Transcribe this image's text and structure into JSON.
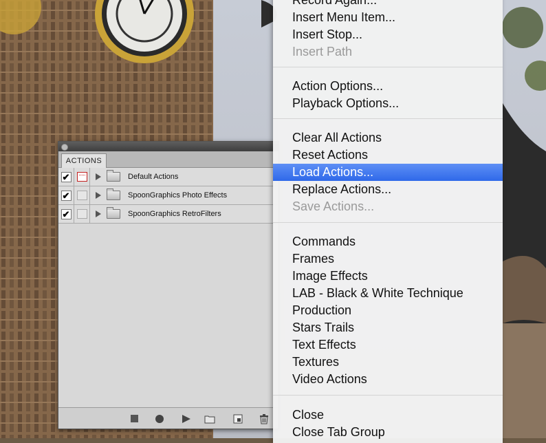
{
  "actions_panel": {
    "tab_label": "ACTIONS",
    "sets": [
      {
        "label": "Default Actions",
        "checked": true,
        "dialog_toggle": "red"
      },
      {
        "label": "SpoonGraphics Photo Effects",
        "checked": true,
        "dialog_toggle": "empty"
      },
      {
        "label": "SpoonGraphics RetroFilters",
        "checked": true,
        "dialog_toggle": "empty"
      }
    ],
    "check_glyph": "✔",
    "footer_icons": [
      "stop-icon",
      "record-icon",
      "play-icon",
      "new-set-folder-icon",
      "new-action-icon",
      "trash-icon"
    ]
  },
  "menu": {
    "items": [
      {
        "label": "Record Again...",
        "state": "normal"
      },
      {
        "label": "Insert Menu Item...",
        "state": "normal"
      },
      {
        "label": "Insert Stop...",
        "state": "normal"
      },
      {
        "label": "Insert Path",
        "state": "disabled"
      },
      {
        "label": "Action Options...",
        "state": "normal"
      },
      {
        "label": "Playback Options...",
        "state": "normal"
      },
      {
        "label": "Clear All Actions",
        "state": "normal"
      },
      {
        "label": "Reset Actions",
        "state": "normal"
      },
      {
        "label": "Load Actions...",
        "state": "highlight"
      },
      {
        "label": "Replace Actions...",
        "state": "normal"
      },
      {
        "label": "Save Actions...",
        "state": "disabled"
      },
      {
        "label": "Commands",
        "state": "normal"
      },
      {
        "label": "Frames",
        "state": "normal"
      },
      {
        "label": "Image Effects",
        "state": "normal"
      },
      {
        "label": "LAB - Black & White Technique",
        "state": "normal"
      },
      {
        "label": "Production",
        "state": "normal"
      },
      {
        "label": "Stars Trails",
        "state": "normal"
      },
      {
        "label": "Text Effects",
        "state": "normal"
      },
      {
        "label": "Textures",
        "state": "normal"
      },
      {
        "label": "Video Actions",
        "state": "normal"
      },
      {
        "label": "Close",
        "state": "normal"
      },
      {
        "label": "Close Tab Group",
        "state": "normal"
      }
    ],
    "highlight_color": "#3f78ee"
  }
}
